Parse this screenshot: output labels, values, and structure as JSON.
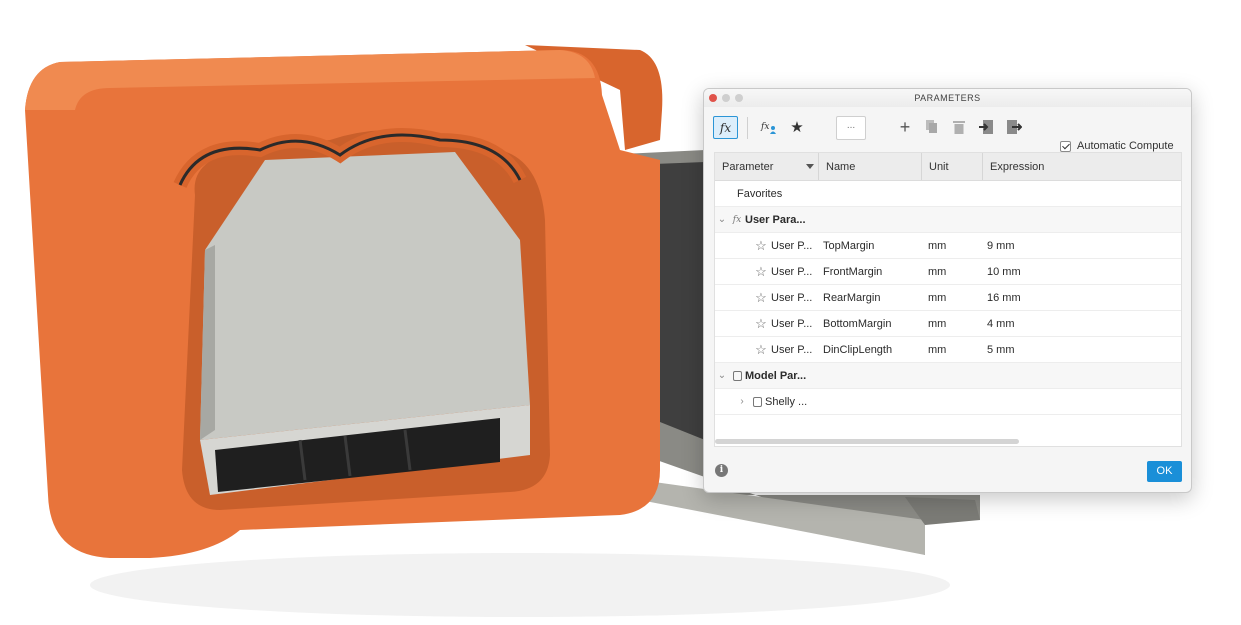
{
  "dialog": {
    "title": "PARAMETERS",
    "search_text": "...",
    "automatic_compute_label": "Automatic Compute",
    "automatic_compute_checked": true,
    "ok_label": "OK"
  },
  "toolbar": {
    "icons": [
      "fx-all-icon",
      "user-fx-icon",
      "favorites-star-icon",
      "add-icon",
      "copy-icon",
      "delete-icon",
      "import-icon",
      "export-icon"
    ]
  },
  "table": {
    "columns": [
      "Parameter",
      "Name",
      "Unit",
      "Expression"
    ],
    "favorites_label": "Favorites",
    "user_group_label": "User Para...",
    "user_rows": [
      {
        "param": "User P...",
        "name": "TopMargin",
        "unit": "mm",
        "expression": "9 mm"
      },
      {
        "param": "User P...",
        "name": "FrontMargin",
        "unit": "mm",
        "expression": "10 mm"
      },
      {
        "param": "User P...",
        "name": "RearMargin",
        "unit": "mm",
        "expression": "16 mm"
      },
      {
        "param": "User P...",
        "name": "BottomMargin",
        "unit": "mm",
        "expression": "4 mm"
      },
      {
        "param": "User P...",
        "name": "DinClipLength",
        "unit": "mm",
        "expression": "5 mm"
      }
    ],
    "model_group_label": "Model Par...",
    "model_child_label": "Shelly ..."
  },
  "colors": {
    "orange": "#e8743b",
    "accent_blue": "#1a8fd8",
    "close_red": "#e0534a"
  }
}
